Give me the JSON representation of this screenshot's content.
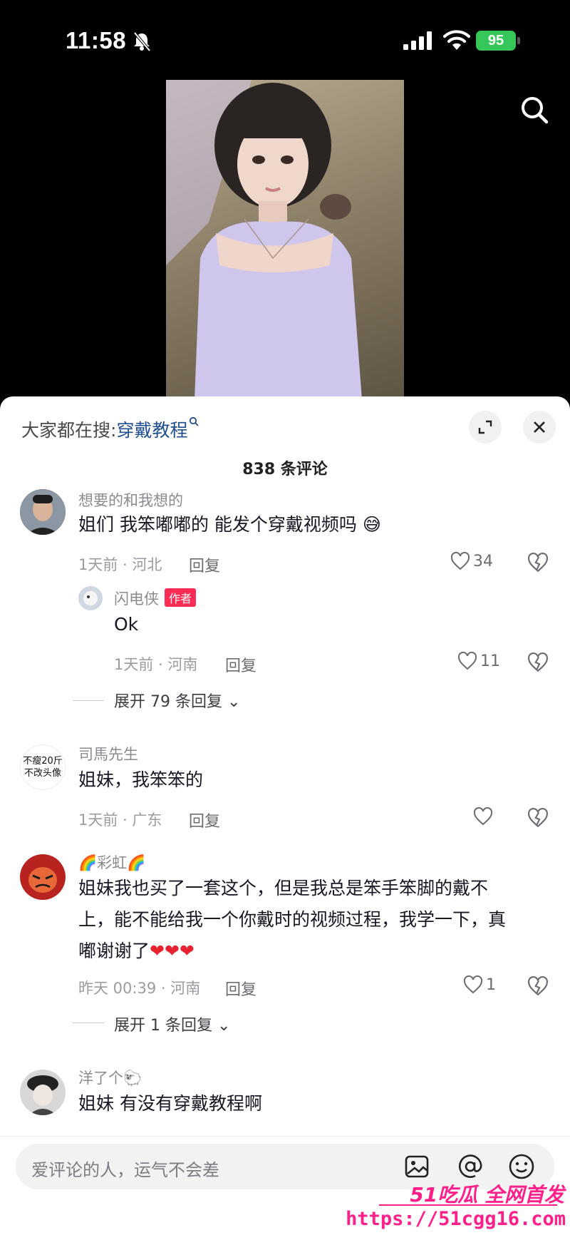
{
  "status": {
    "time": "11:58",
    "battery": "95"
  },
  "sheet": {
    "search_prefix": "大家都在搜:",
    "search_keyword": "穿戴教程",
    "comment_count": "838 条评论"
  },
  "comments": [
    {
      "user": "想要的和我想的",
      "text": "姐们 我笨嘟嘟的 能发个穿戴视频吗",
      "emoji": "😅",
      "meta": "1天前 · 河北",
      "reply": "回复",
      "likes": "34",
      "replies": [
        {
          "user": "闪电侠",
          "tag": "作者",
          "text": "Ok",
          "meta": "1天前 · 河南",
          "reply": "回复",
          "likes": "11"
        }
      ],
      "expand": "展开 79 条回复"
    },
    {
      "user": "司馬先生",
      "avatar_text": "不瘦20斤 不改头像",
      "text": "姐妹，我笨笨的",
      "meta": "1天前 · 广东",
      "reply": "回复",
      "likes": ""
    },
    {
      "user": "彩虹",
      "user_emoji": "🌈",
      "text_line1": "姐妹我也买了一套这个，但是我总是笨手笨脚的戴不",
      "text_line2": "上，能不能给我一个你戴时的视频过程，我学一下，真",
      "text_line3": "嘟谢谢了",
      "meta": "昨天 00:39 · 河南",
      "reply": "回复",
      "likes": "1",
      "expand": "展开 1 条回复"
    },
    {
      "user": "洋了个",
      "user_emoji": "🐑",
      "text": "姐妹 有没有穿戴教程啊"
    }
  ],
  "input": {
    "placeholder": "爱评论的人，运气不会差"
  },
  "watermark": {
    "brand": "51吃瓜 全网首发",
    "url": "https://51cgg16.com"
  },
  "icons": [
    "bell-off-icon",
    "signal-icon",
    "wifi-icon",
    "battery-icon",
    "search-icon",
    "expand-icon",
    "close-icon",
    "heart-icon",
    "dislike-icon",
    "chevron-down-icon",
    "image-icon",
    "at-icon",
    "emoji-icon"
  ]
}
